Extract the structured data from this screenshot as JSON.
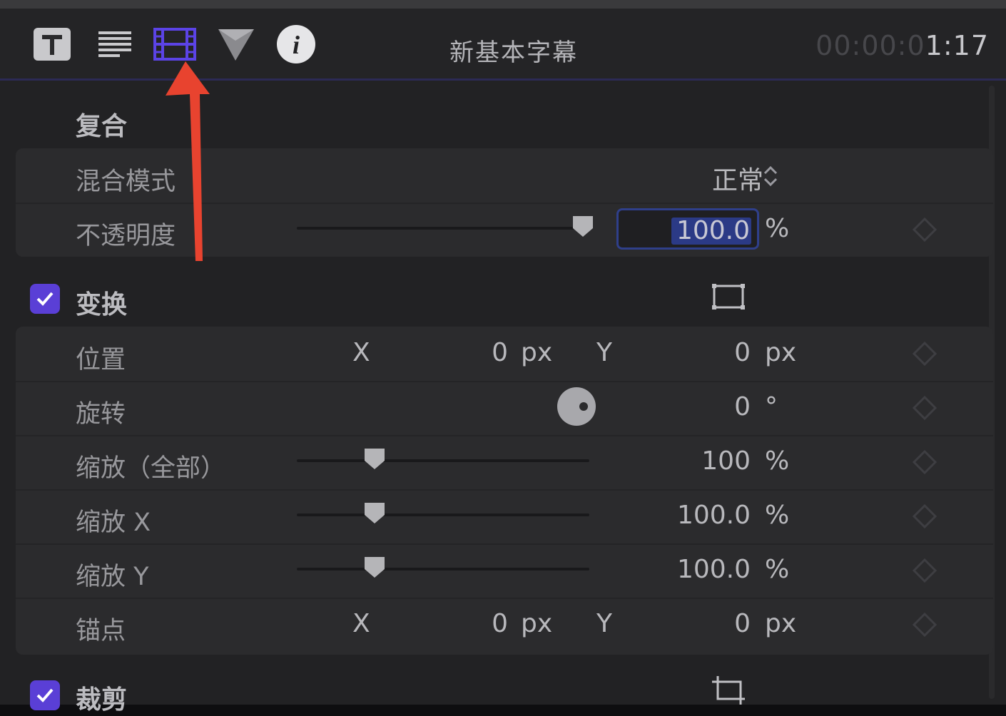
{
  "header": {
    "tabs": [
      {
        "icon": "text-icon",
        "active": false
      },
      {
        "icon": "paragraph-icon",
        "active": false
      },
      {
        "icon": "video-icon",
        "active": true
      },
      {
        "icon": "filter-triangle-icon",
        "active": false
      },
      {
        "icon": "info-icon",
        "active": false,
        "glyph": "i"
      }
    ],
    "title": "新基本字幕",
    "timecode_dim": "00:00:0",
    "timecode_bright": "1:17"
  },
  "annotation": {
    "color": "#e8432f",
    "points_to": "video-icon"
  },
  "compositing": {
    "title": "复合",
    "blend_mode_label": "混合模式",
    "blend_mode_value": "正常",
    "blend_mode_stepper": "⌃⌄",
    "opacity_label": "不透明度",
    "opacity_value": "100.0",
    "opacity_unit": "%",
    "opacity_slider": 1.0
  },
  "transform": {
    "title": "变换",
    "enabled": true,
    "position": {
      "label": "位置",
      "x_axis": "X",
      "x_value": "0",
      "x_unit": "px",
      "y_axis": "Y",
      "y_value": "0",
      "y_unit": "px"
    },
    "rotation": {
      "label": "旋转",
      "value": "0",
      "unit": "°"
    },
    "scale_all": {
      "label": "缩放（全部）",
      "value": "100",
      "unit": "%",
      "slider": 0.27
    },
    "scale_x": {
      "label": "缩放 X",
      "value": "100.0",
      "unit": "%",
      "slider": 0.27
    },
    "scale_y": {
      "label": "缩放 Y",
      "value": "100.0",
      "unit": "%",
      "slider": 0.27
    },
    "anchor": {
      "label": "锚点",
      "x_axis": "X",
      "x_value": "0",
      "x_unit": "px",
      "y_axis": "Y",
      "y_value": "0",
      "y_unit": "px"
    }
  },
  "crop": {
    "title": "裁剪",
    "enabled": true
  },
  "colors": {
    "accent": "#5a3fd6",
    "panel": "#222224",
    "row": "#2b2b2d"
  }
}
